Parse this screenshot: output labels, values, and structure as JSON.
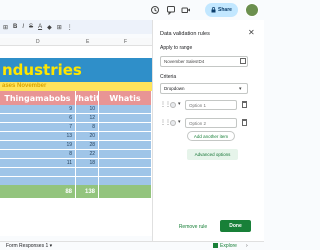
{
  "header": {
    "share_label": "Share",
    "icons": [
      "history-icon",
      "comment-icon",
      "video-call-icon",
      "lock-icon"
    ]
  },
  "toolbar": {
    "items": [
      "⊞",
      "B",
      "I",
      "S",
      "A",
      "◆",
      "⊞",
      "⋮"
    ]
  },
  "columns": [
    "D",
    "E",
    "F"
  ],
  "sheet": {
    "title": "ndustries",
    "subtitle": "ases November",
    "headers": [
      "Thingamabobs",
      "Whatits",
      "Whatis"
    ],
    "rows": [
      {
        "a": "9",
        "b": "10"
      },
      {
        "a": "6",
        "b": "12"
      },
      {
        "a": "7",
        "b": "8"
      },
      {
        "a": "13",
        "b": "20"
      },
      {
        "a": "19",
        "b": "28"
      },
      {
        "a": "8",
        "b": "22"
      },
      {
        "a": "11",
        "b": "18"
      },
      {
        "a": "",
        "b": ""
      },
      {
        "a": "",
        "b": ""
      },
      {
        "a": "",
        "b": ""
      }
    ],
    "totals": {
      "a": "88",
      "b": "138"
    }
  },
  "panel": {
    "title": "Data validation rules",
    "apply_label": "Apply to range",
    "range_value": "November Sales!D4",
    "criteria_label": "Criteria",
    "criteria_value": "Dropdown",
    "options": [
      {
        "placeholder": "Option 1"
      },
      {
        "placeholder": "Option 2"
      }
    ],
    "add_item_label": "Add another item",
    "advanced_label": "Advanced options",
    "remove_label": "Remove rule",
    "done_label": "Done"
  },
  "bottom": {
    "sheet_tab": "Form Responses 1 ▾",
    "explore_label": "Explore"
  },
  "colors": {
    "title_bg": "#2f8fc9",
    "title_text": "#ffe600",
    "header_bg": "#e89595",
    "data_bg": "#9fc5e8",
    "total_bg": "#93c47d",
    "accent": "#188038"
  }
}
